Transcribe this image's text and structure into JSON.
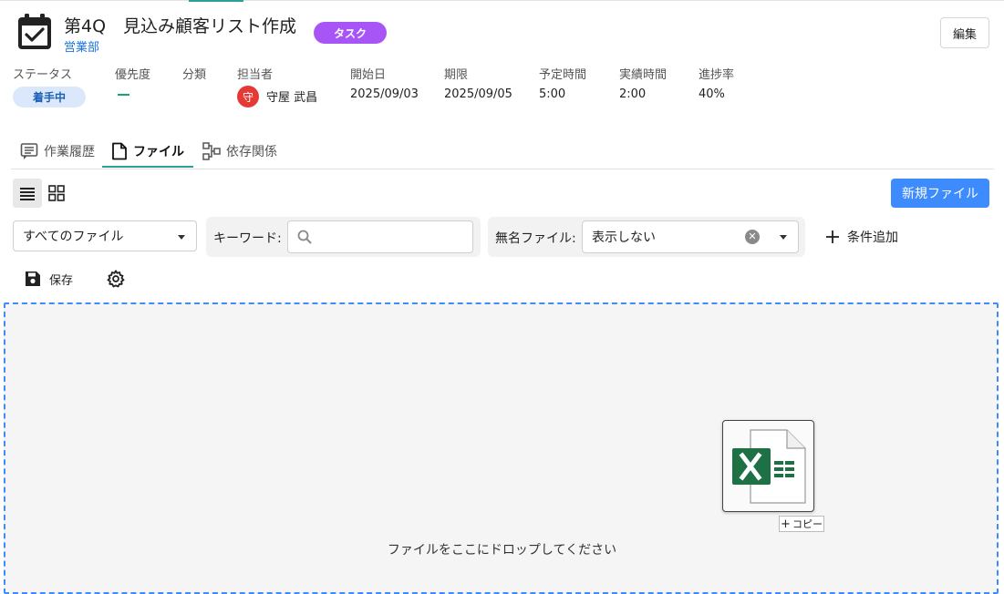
{
  "task": {
    "title": "第4Q　見込み顧客リスト作成",
    "department": "営業部",
    "type_badge": "タスク",
    "edit_label": "編集"
  },
  "meta": {
    "status_label": "ステータス",
    "status_value": "着手中",
    "priority_label": "優先度",
    "category_label": "分類",
    "assignee_label": "担当者",
    "assignee_avatar": "守",
    "assignee_name": "守屋 武昌",
    "start_label": "開始日",
    "start_value": "2025/09/03",
    "due_label": "期限",
    "due_value": "2025/09/05",
    "planned_label": "予定時間",
    "planned_value": "5:00",
    "actual_label": "実績時間",
    "actual_value": "2:00",
    "progress_label": "進捗率",
    "progress_value": "40%"
  },
  "tabs": [
    {
      "label": "作業履歴",
      "icon": "message-icon"
    },
    {
      "label": "ファイル",
      "icon": "file-icon"
    },
    {
      "label": "依存関係",
      "icon": "dependency-icon"
    }
  ],
  "toolbar": {
    "new_file_label": "新規ファイル",
    "file_filter_value": "すべてのファイル",
    "keyword_label": "キーワード:",
    "keyword_placeholder": "",
    "noname_label": "無名ファイル:",
    "noname_value": "表示しない",
    "add_condition_label": "条件追加",
    "save_label": "保存"
  },
  "dropzone": {
    "text": "ファイルをここにドロップしてください",
    "copy_label": "コピー",
    "drag_file_icon": "excel-file-icon"
  },
  "colors": {
    "accent": "#2aa198",
    "primary": "#3d8bfd",
    "badge_purple": "#a855f7",
    "status_bg": "#dbe8fb",
    "avatar_red": "#e53935",
    "excel_green": "#1e7145"
  }
}
